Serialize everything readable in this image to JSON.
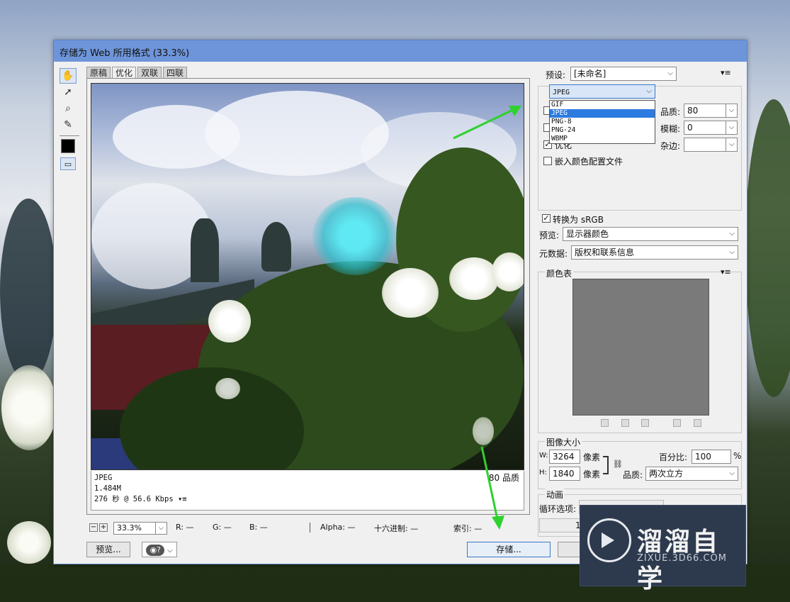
{
  "dialog": {
    "title": "存储为 Web 所用格式 (33.3%)"
  },
  "tools": [
    {
      "name": "hand-tool",
      "glyph": "✋"
    },
    {
      "name": "slice-select-tool",
      "glyph": "↗"
    },
    {
      "name": "zoom-tool",
      "glyph": "🔍"
    },
    {
      "name": "eyedropper-tool",
      "glyph": "✎"
    }
  ],
  "view_tabs": [
    "原稿",
    "优化",
    "双联",
    "四联"
  ],
  "image_info": {
    "format": "JPEG",
    "size": "1.484M",
    "time": "276 秒 @ 56.6 Kbps",
    "time_menu": "▾≡",
    "quality": "80 品质"
  },
  "status": {
    "zoom": "33.3%",
    "r": "R: —",
    "g": "G: —",
    "b": "B: —",
    "alpha": "Alpha: —",
    "hex": "十六进制: —",
    "index": "索引: —"
  },
  "buttons": {
    "preview": "预览...",
    "save": "存储..."
  },
  "settings": {
    "preset_label": "预设:",
    "preset_value": "[未命名]",
    "format_value": "JPEG",
    "format_options": [
      "GIF",
      "JPEG",
      "PNG-8",
      "PNG-24",
      "WBMP"
    ],
    "quality_label": "品质:",
    "quality_value": "80",
    "blur_label": "模糊:",
    "blur_value": "0",
    "matte_label": "杂边:",
    "optimized_label": "优化",
    "embed_profile_label": "嵌入颜色配置文件",
    "convert_srgb_label": "转换为 sRGB",
    "preview_label": "预览:",
    "preview_value": "显示器颜色",
    "metadata_label": "元数据:",
    "metadata_value": "版权和联系信息"
  },
  "color_table": {
    "title": "颜色表"
  },
  "image_size": {
    "title": "图像大小",
    "w_label": "W:",
    "w_value": "3264",
    "h_label": "H:",
    "h_value": "1840",
    "unit": "像素",
    "percent_label": "百分比:",
    "percent_value": "100",
    "percent_unit": "%",
    "quality_label": "品质:",
    "quality_value": "两次立方"
  },
  "animation": {
    "title": "动画",
    "loop_label": "循环选项:",
    "frame": "1"
  },
  "watermark": {
    "title": "溜溜自学",
    "sub": "ZIXUE.3D66.COM"
  },
  "colors": {
    "title_bar": "#6e95d9",
    "arrow": "#2fd12f",
    "selected": "#2c7be0"
  }
}
